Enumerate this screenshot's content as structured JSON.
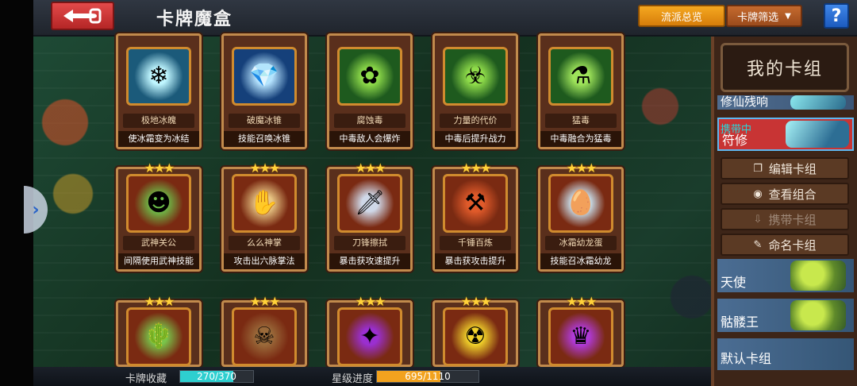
{
  "header": {
    "title": "卡牌魔盒",
    "overview_btn": "流派总览",
    "filter_btn": "卡牌筛选",
    "help": "?"
  },
  "cards": [
    {
      "name": "极地冰魄",
      "desc": "使冰霜变为冰结",
      "stars": "",
      "art": "❄",
      "bg": "#1b5a7a",
      "glow": "#bff6ff"
    },
    {
      "name": "破魔冰锥",
      "desc": "技能召唤冰锥",
      "stars": "",
      "art": "💎",
      "bg": "#15407a",
      "glow": "#b6e4ff"
    },
    {
      "name": "腐蚀毒",
      "desc": "中毒敌人会爆炸",
      "stars": "",
      "art": "✿",
      "bg": "#1e5a1e",
      "glow": "#8fdc4a"
    },
    {
      "name": "力量的代价",
      "desc": "中毒后提升战力",
      "stars": "",
      "art": "☣",
      "bg": "#1e5a1e",
      "glow": "#8fdc4a"
    },
    {
      "name": "猛毒",
      "desc": "中毒融合为猛毒",
      "stars": "",
      "art": "⚗",
      "bg": "#1e5a1e",
      "glow": "#9ee35a"
    },
    {
      "name": "武神关公",
      "desc": "间隔使用武神技能",
      "stars": "★★★",
      "art": "☻",
      "bg": "#7a2a12",
      "glow": "#6dc04a"
    },
    {
      "name": "么么神掌",
      "desc": "攻击出六脉掌法",
      "stars": "★★★",
      "art": "✋",
      "bg": "#7a2a12",
      "glow": "#e9c784"
    },
    {
      "name": "刀锋擦拭",
      "desc": "暴击获攻速提升",
      "stars": "★★★",
      "art": "🗡",
      "bg": "#7a2a12",
      "glow": "#cfd8e8"
    },
    {
      "name": "千锤百炼",
      "desc": "暴击获攻击提升",
      "stars": "★★★",
      "art": "⚒",
      "bg": "#7a2a12",
      "glow": "#e05a2a"
    },
    {
      "name": "冰霜幼龙蛋",
      "desc": "技能召冰霜幼龙",
      "stars": "★★★",
      "art": "🥚",
      "bg": "#7a2a12",
      "glow": "#cfefff"
    },
    {
      "name": "",
      "desc": "",
      "stars": "★★★",
      "art": "🌵",
      "bg": "#7a2a12",
      "glow": "#79c44a"
    },
    {
      "name": "",
      "desc": "",
      "stars": "★★★",
      "art": "☠",
      "bg": "#7a2a12",
      "glow": "#9a6a3a"
    },
    {
      "name": "",
      "desc": "",
      "stars": "★★★",
      "art": "✦",
      "bg": "#7a2a12",
      "glow": "#9a2fd0"
    },
    {
      "name": "",
      "desc": "",
      "stars": "★★★",
      "art": "☢",
      "bg": "#7a2a12",
      "glow": "#f0d02a"
    },
    {
      "name": "",
      "desc": "",
      "stars": "★★★",
      "art": "♛",
      "bg": "#7a2a12",
      "glow": "#b03ad8"
    }
  ],
  "panel": {
    "title": "我的卡组",
    "decks": {
      "xiuxian": "修仙残响",
      "carry_tag": "携带中",
      "fuxiu": "符修",
      "tianshi": "天使",
      "kulou": "骷髅王",
      "default": "默认卡组"
    },
    "actions": {
      "edit": "编辑卡组",
      "view": "查看组合",
      "carry": "携带卡组",
      "rename": "命名卡组"
    }
  },
  "progress": {
    "collection_label": "卡牌收藏",
    "collection_text": "270/370",
    "collection_value": 0.7297,
    "star_label": "星级进度",
    "star_text": "695/1110",
    "star_value": 0.6261
  },
  "colors": {
    "collection_fill": "#2ecfd0",
    "star_fill": "#f2a21e"
  }
}
